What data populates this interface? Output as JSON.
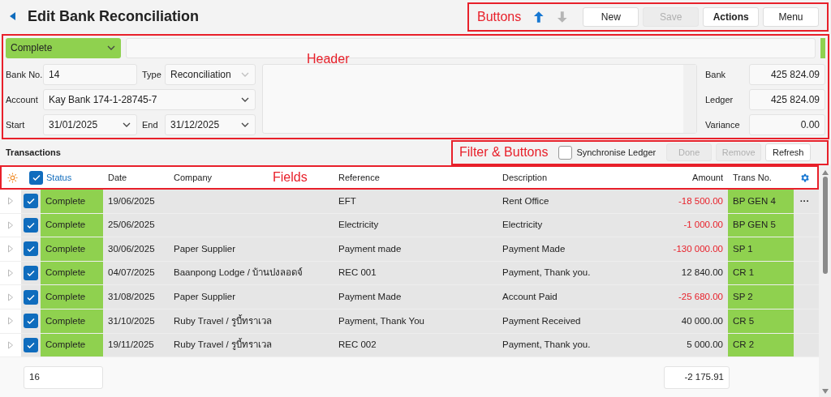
{
  "title": "Edit Bank Reconciliation",
  "toolbar": {
    "annotation": "Buttons",
    "up_enabled": true,
    "down_enabled": false,
    "buttons": [
      {
        "label": "New",
        "disabled": false,
        "bold": false
      },
      {
        "label": "Save",
        "disabled": true,
        "bold": false
      },
      {
        "label": "Actions",
        "disabled": false,
        "bold": true
      },
      {
        "label": "Menu",
        "disabled": false,
        "bold": false
      }
    ]
  },
  "header": {
    "annotation": "Header",
    "status": "Complete",
    "bank_no": {
      "label": "Bank No.",
      "value": "14"
    },
    "type": {
      "label": "Type",
      "value": "Reconciliation"
    },
    "account": {
      "label": "Account",
      "value": "Kay Bank 174-1-28745-7"
    },
    "start": {
      "label": "Start",
      "value": "31/01/2025"
    },
    "end": {
      "label": "End",
      "value": "31/12/2025"
    },
    "totals": [
      {
        "label": "Bank",
        "value": "425 824.09"
      },
      {
        "label": "Ledger",
        "value": "425 824.09"
      },
      {
        "label": "Variance",
        "value": "0.00"
      }
    ]
  },
  "section_title": "Transactions",
  "filter_bar": {
    "annotation": "Filter & Buttons",
    "sync": {
      "label": "Synchronise Ledger",
      "checked": false
    },
    "buttons": [
      {
        "label": "Done",
        "disabled": true
      },
      {
        "label": "Remove",
        "disabled": true
      },
      {
        "label": "Refresh",
        "disabled": false
      }
    ]
  },
  "table": {
    "annotation": "Fields",
    "all_checked": true,
    "columns": [
      "Status",
      "Date",
      "Company",
      "Reference",
      "Description",
      "Amount",
      "Trans No."
    ],
    "rows": [
      {
        "checked": true,
        "status": "Complete",
        "date": "19/06/2025",
        "company": "",
        "reference": "EFT",
        "description": "Rent Office",
        "amount": "-18 500.00",
        "negative": true,
        "trans_no": "BP GEN 4",
        "more": "···"
      },
      {
        "checked": true,
        "status": "Complete",
        "date": "25/06/2025",
        "company": "",
        "reference": "Electricity",
        "description": "Electricity",
        "amount": "-1 000.00",
        "negative": true,
        "trans_no": "BP GEN 5"
      },
      {
        "checked": true,
        "status": "Complete",
        "date": "30/06/2025",
        "company": "Paper Supplier",
        "reference": "Payment made",
        "description": "Payment Made",
        "amount": "-130 000.00",
        "negative": true,
        "trans_no": "SP 1"
      },
      {
        "checked": true,
        "status": "Complete",
        "date": "04/07/2025",
        "company": "Baanpong Lodge / บ้านปงลอดจ์",
        "reference": "REC 001",
        "description": "Payment, Thank you.",
        "amount": "12 840.00",
        "negative": false,
        "trans_no": "CR 1"
      },
      {
        "checked": true,
        "status": "Complete",
        "date": "31/08/2025",
        "company": "Paper Supplier",
        "reference": "Payment Made",
        "description": "Account Paid",
        "amount": "-25 680.00",
        "negative": true,
        "trans_no": "SP 2"
      },
      {
        "checked": true,
        "status": "Complete",
        "date": "31/10/2025",
        "company": "Ruby Travel / รูบี้ทราเวล",
        "reference": "Payment, Thank You",
        "description": "Payment Received",
        "amount": "40 000.00",
        "negative": false,
        "trans_no": "CR 5"
      },
      {
        "checked": true,
        "status": "Complete",
        "date": "19/11/2025",
        "company": "Ruby Travel / รูบี้ทราเวล",
        "reference": "REC 002",
        "description": "Payment, Thank you.",
        "amount": "5 000.00",
        "negative": false,
        "trans_no": "CR 2"
      }
    ],
    "footer": {
      "count": "16",
      "total": "-2 175.91"
    }
  }
}
